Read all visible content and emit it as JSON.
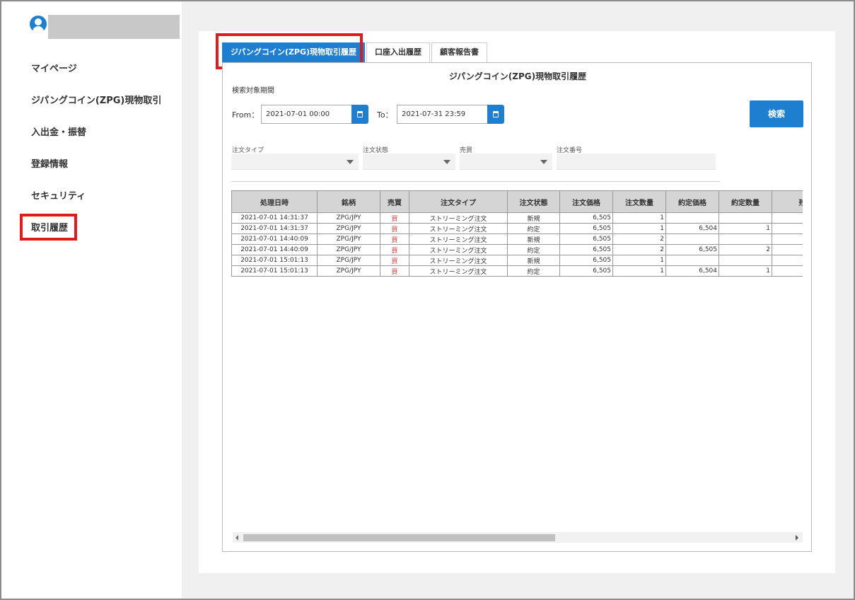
{
  "sidebar": {
    "items": [
      {
        "label": "マイページ"
      },
      {
        "label": "ジパングコイン(ZPG)現物取引"
      },
      {
        "label": "入出金・振替"
      },
      {
        "label": "登録情報"
      },
      {
        "label": "セキュリティ"
      },
      {
        "label": "取引履歴"
      }
    ]
  },
  "tabs": [
    {
      "label": "ジパングコイン(ZPG)現物取引履歴"
    },
    {
      "label": "口座入出履歴"
    },
    {
      "label": "顧客報告書"
    }
  ],
  "panel": {
    "title": "ジパングコイン(ZPG)現物取引履歴",
    "period_label": "検索対象期間",
    "from_label": "From：",
    "from_value": "2021-07-01 00:00",
    "to_label": "To：",
    "to_value": "2021-07-31 23:59",
    "search_label": "検索"
  },
  "filters": [
    {
      "label": "注文タイプ",
      "value": ""
    },
    {
      "label": "注文状態",
      "value": ""
    },
    {
      "label": "売買",
      "value": ""
    },
    {
      "label": "注文番号",
      "value": ""
    }
  ],
  "table": {
    "headers": [
      "処理日時",
      "銘柄",
      "売買",
      "注文タイプ",
      "注文状態",
      "注文価格",
      "注文数量",
      "約定価格",
      "約定数量",
      "残数"
    ],
    "rows": [
      [
        "2021-07-01 14:31:37",
        "ZPG/JPY",
        "買",
        "ストリーミング注文",
        "新規",
        "6,505",
        "1",
        "",
        "",
        ""
      ],
      [
        "2021-07-01 14:31:37",
        "ZPG/JPY",
        "買",
        "ストリーミング注文",
        "約定",
        "6,505",
        "1",
        "6,504",
        "1",
        ""
      ],
      [
        "2021-07-01 14:40:09",
        "ZPG/JPY",
        "買",
        "ストリーミング注文",
        "新規",
        "6,505",
        "2",
        "",
        "",
        ""
      ],
      [
        "2021-07-01 14:40:09",
        "ZPG/JPY",
        "買",
        "ストリーミング注文",
        "約定",
        "6,505",
        "2",
        "6,505",
        "2",
        ""
      ],
      [
        "2021-07-01 15:01:13",
        "ZPG/JPY",
        "買",
        "ストリーミング注文",
        "新規",
        "6,505",
        "1",
        "",
        "",
        ""
      ],
      [
        "2021-07-01 15:01:13",
        "ZPG/JPY",
        "買",
        "ストリーミング注文",
        "約定",
        "6,505",
        "1",
        "6,504",
        "1",
        ""
      ]
    ]
  },
  "colors": {
    "accent": "#1e7fd0",
    "highlight": "#e01b1b",
    "buy": "#e04040"
  }
}
